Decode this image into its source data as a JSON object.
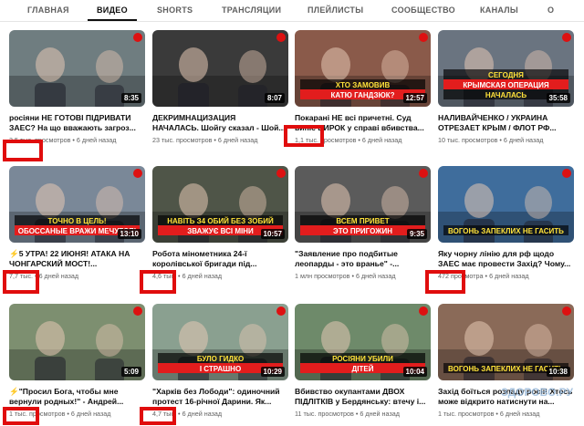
{
  "tabs": [
    "ГЛАВНАЯ",
    "ВИДЕО",
    "SHORTS",
    "ТРАНСЛЯЦИИ",
    "ПЛЕЙЛИСТЫ",
    "СООБЩЕСТВО",
    "КАНАЛЫ",
    "О"
  ],
  "active_tab": "ВИДЕО",
  "videos": [
    {
      "title": "росіяни НЕ ГОТОВІ ПІДРИВАТИ\nЗАЕС? На що вважають загроз...",
      "views": "3,5 тыс. просмотров",
      "age": "6 дней назад",
      "duration": "8:35",
      "thumb_text": "",
      "bg": "#6f7d80"
    },
    {
      "title": "ДЕКРИМНАЦИЗАЦИЯ\nНАЧАЛАСЬ. Шойгу сказал - Шой...",
      "views": "23 тыс. просмотров",
      "age": "6 дней назад",
      "duration": "8:07",
      "thumb_text": "",
      "bg": "#3a3a3a"
    },
    {
      "title": "Покарані НЕ всі причетні. Суд\nвиніс ВИРОК у справі вбивства...",
      "views": "1,1 тыс. просмотров",
      "age": "6 дней назад",
      "duration": "12:57",
      "thumb_text": "ХТО ЗАМОВИВ\nКАТЮ ГАНДЗЮК?",
      "bg": "#8a5a4a"
    },
    {
      "title": "НАЛИВАЙЧЕНКО / УКРАИНА\nОТРЕЗАЕТ КРЫМ / ФЛОТ РФ...",
      "views": "10 тыс. просмотров",
      "age": "6 дней назад",
      "duration": "35:58",
      "thumb_text": "СЕГОДНЯ\nКРЫМСКАЯ ОПЕРАЦИЯ\nНАЧАЛАСЬ",
      "bg": "#6a7480"
    },
    {
      "title": "⚡5 УТРА! 22 ИЮНЯ! АТАКА НА\nЧОНГАРСКИЙ МОСТ!...",
      "views": "7,7 тыс.",
      "age": "6 дней назад",
      "duration": "13:10",
      "thumb_text": "ТОЧНО В ЦЕЛЬ!\nОБОССАНЫЕ ВРАЖИ МЕЧУТСЯ!",
      "bg": "#7a8898"
    },
    {
      "title": "Робота мінометника 24-ї\nкоролівської бригади під...",
      "views": "4,6 тыс.",
      "age": "6 дней назад",
      "duration": "10:57",
      "thumb_text": "НАВІТЬ З4 ОБИЙ БЕЗ ЗОБИЙ\nЗВАЖУЄ ВСІ МІНИ",
      "bg": "#4f5548"
    },
    {
      "title": "\"Заявление про подбитые\nлеопарды - это вранье\" -...",
      "views": "1 млн просмотров",
      "age": "6 дней назад",
      "duration": "9:35",
      "thumb_text": "ВСЕМ ПРИВЕТ\nЭТО ПРИГОЖИН",
      "bg": "#5b5b5b"
    },
    {
      "title": "Яку чорну лінію для рф щодо\nЗАЕС має провести Захід? Чому...",
      "views": "472 просмотра",
      "age": "6 дней назад",
      "duration": "",
      "thumb_text": "ВОГОНЬ ЗАПЕКЛИХ НЕ ГАСИТЬ",
      "bg": "#3f6d9c"
    },
    {
      "title": "⚡\"Просил Бога, чтобы мне\nвернули родных!\" - Андрей...",
      "views": "1 тыс. просмотров",
      "age": "6 дней назад",
      "duration": "5:09",
      "thumb_text": "",
      "bg": "#7d8f70"
    },
    {
      "title": "\"Харків без Лободи\": одиночний\nпротест 16-річної Дарини. Як...",
      "views": "4,7 тыс.",
      "age": "6 дней назад",
      "duration": "10:29",
      "thumb_text": "БУЛО ГИДКО\nІ СТРАШНО",
      "bg": "#8aa090"
    },
    {
      "title": "Вбивство окупантами ДВОХ\nПІДЛІТКІВ у Бердянську: втечу і...",
      "views": "11 тыс. просмотров",
      "age": "6 дней назад",
      "duration": "10:04",
      "thumb_text": "РОСІЯНИ УБИЛИ\nДІТЕЙ",
      "bg": "#6e8a6a"
    },
    {
      "title": "Захід боїться розпаду росії! Хтось\nможе відкрито натиснути на...",
      "views": "1 тыс. просмотров",
      "age": "6 дней назад",
      "duration": "10:38",
      "thumb_text": "ВОГОНЬ ЗАПЕКЛИХ НЕ ГАСИТЬ",
      "bg": "#8a6a58"
    }
  ],
  "watermark": "ЗДОРОВО.РУ",
  "colors": {
    "highlight": "#e00d0d",
    "caption_yellow": "#ffe23a",
    "caption_red": "#e21d1d",
    "text_meta": "#606060"
  }
}
